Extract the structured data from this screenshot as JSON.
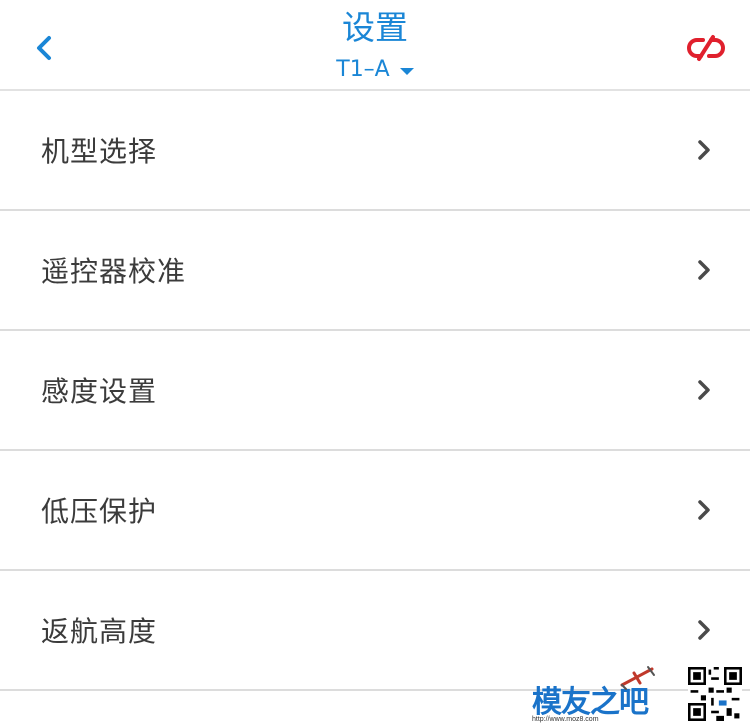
{
  "header": {
    "title": "设置",
    "subtitle": "T1–A"
  },
  "menu": {
    "items": [
      {
        "label": "机型选择"
      },
      {
        "label": "遥控器校准"
      },
      {
        "label": "感度设置"
      },
      {
        "label": "低压保护"
      },
      {
        "label": "返航高度"
      }
    ]
  },
  "watermark": {
    "text": "模友之吧",
    "url": "http://www.moz8.com"
  },
  "colors": {
    "accent": "#1a86d6",
    "disconnect": "#e0202d",
    "text": "#3b3b3b",
    "divider": "#dcdcdc"
  },
  "icons": {
    "back": "chevron-left-icon",
    "disconnect": "unlink-icon",
    "row_arrow": "chevron-right-icon",
    "dropdown": "caret-down-icon"
  }
}
